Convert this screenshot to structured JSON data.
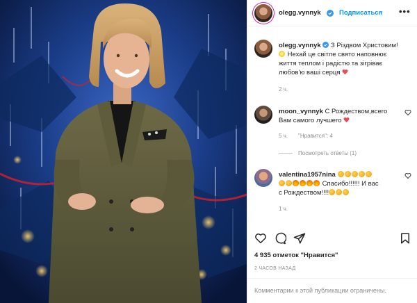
{
  "header": {
    "username": "olegg.vynnyk",
    "follow_label": "Подписаться",
    "more_label": "•••"
  },
  "caption": {
    "username": "olegg.vynnyk",
    "line1_suffix": "З Різдвом Христовим!",
    "line2": "Нехай це світле свято наповнює",
    "line3": "життя теплом і радістю та зігріває",
    "line4": "любов'ю ваші серця",
    "time": "2 ч."
  },
  "comments": [
    {
      "username": "moon_vynnyk",
      "line1": "С Рождеством,всего",
      "line2": "Вам самого лучшего",
      "time": "5 ч.",
      "likes_label": "\"Нравится\": 4",
      "view_replies": "Посмотреть ответы (1)"
    },
    {
      "username": "valentina1957nina",
      "line2_text": "Спасибо!!!!!! И вас",
      "line3_text": "с Рождеством!!!!",
      "time": "1 ч."
    }
  ],
  "likes": {
    "count_text": "4 935 отметок \"Нравится\""
  },
  "post_time": "2 ЧАСОВ НАЗАД",
  "footer_text": "Комментарии к этой публикации ограничены.",
  "colors": {
    "accent": "#0095f6",
    "heart": "#ed4956",
    "muted": "#8e8e8e",
    "text": "#262626"
  },
  "icons": {
    "like": "heart-outline-icon",
    "comment": "speech-bubble-icon",
    "share": "paper-plane-icon",
    "save": "bookmark-icon",
    "verified": "verified-badge-icon",
    "comment_like": "heart-outline-icon"
  }
}
